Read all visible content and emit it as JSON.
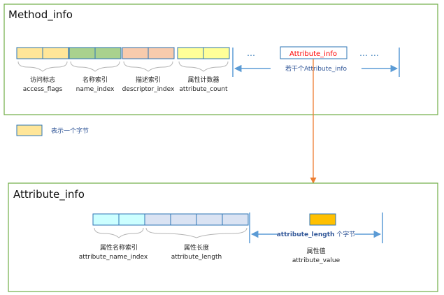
{
  "method_info": {
    "title": "Method_info",
    "fields": [
      {
        "cn": "访问标志",
        "en": "access_flags",
        "fill": "#ffe699",
        "cells": 2
      },
      {
        "cn": "名称索引",
        "en": "name_index",
        "fill": "#a9d18e",
        "cells": 2
      },
      {
        "cn": "描述索引",
        "en": "descriptor_index",
        "fill": "#f8cbad",
        "cells": 2
      },
      {
        "cn": "属性计数器",
        "en": "attribute_count",
        "fill": "#ffff99",
        "cells": 2
      }
    ],
    "left_dots": "…",
    "attribute_box": "Attribute_info",
    "right_dots": "… …",
    "span_label": "若干个Attribute_info"
  },
  "legend": {
    "text": "表示一个字节",
    "fill": "#ffe699"
  },
  "attribute_info": {
    "title": "Attribute_info",
    "fields": [
      {
        "cn": "属性名称索引",
        "en": "attribute_name_index",
        "fill": "#ccffff",
        "cells": 2
      },
      {
        "cn": "属性长度",
        "en": "attribute_length",
        "fill": "#dae3f3",
        "cells": 4
      }
    ],
    "value_cn": "属性值",
    "value_en": "attribute_value",
    "value_fill": "#ffc000",
    "span_label_bold": "attribute_length",
    "span_label_tail": " 个字节"
  },
  "colors": {
    "frame": "#70ad47",
    "cell_border": "#2e75b6",
    "arrow_blue": "#5b9bd5",
    "arrow_orange": "#ed7d31",
    "attr_text": "#ff0000",
    "brace": "#b4b4b4"
  }
}
